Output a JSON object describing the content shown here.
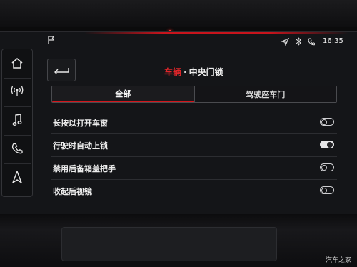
{
  "status_bar": {
    "time": "16:35",
    "icons": [
      "location-arrow-icon",
      "bluetooth-icon",
      "phone-icon"
    ]
  },
  "left_nav": {
    "items": [
      {
        "icon": "home-icon"
      },
      {
        "icon": "radio-antenna-icon"
      },
      {
        "icon": "music-note-icon"
      },
      {
        "icon": "phone-icon"
      },
      {
        "icon": "navigation-arrow-icon"
      }
    ]
  },
  "header": {
    "category": "车辆",
    "separator": "·",
    "subtitle": "中央门锁"
  },
  "tabs": [
    {
      "label": "全部",
      "active": true
    },
    {
      "label": "驾驶座车门",
      "active": false
    }
  ],
  "settings": [
    {
      "label": "长按以打开车窗",
      "enabled": false
    },
    {
      "label": "行驶时自动上锁",
      "enabled": true
    },
    {
      "label": "禁用后备箱盖把手",
      "enabled": false
    },
    {
      "label": "收起后视镜",
      "enabled": false
    }
  ],
  "watermark": "汽车之家",
  "colors": {
    "accent": "#d2161c",
    "background": "#141518",
    "text": "#ececec"
  }
}
